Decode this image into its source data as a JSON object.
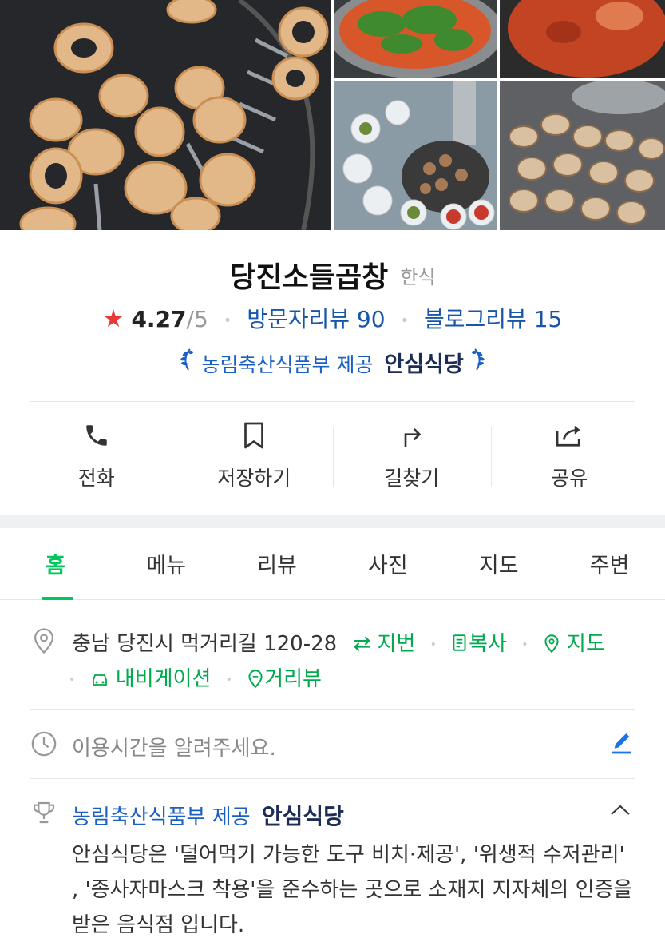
{
  "restaurant": {
    "name": "당진소들곱창",
    "category": "한식",
    "rating_star": "★",
    "rating": "4.27",
    "rating_max": "/5",
    "visitor_reviews": "방문자리뷰 90",
    "blog_reviews": "블로그리뷰 15"
  },
  "certification": {
    "provider": "농림축산식품부 제공",
    "badge": "안심식당"
  },
  "actions": [
    {
      "label": "전화",
      "icon": "phone-icon"
    },
    {
      "label": "저장하기",
      "icon": "bookmark-icon"
    },
    {
      "label": "길찾기",
      "icon": "directions-icon"
    },
    {
      "label": "공유",
      "icon": "share-icon"
    }
  ],
  "tabs": [
    "홈",
    "메뉴",
    "리뷰",
    "사진",
    "지도",
    "주변"
  ],
  "active_tab": "홈",
  "address": {
    "text": "충남 당진시 먹거리길 120-28",
    "jibun": "지번",
    "copy": "복사",
    "map": "지도",
    "navigation": "내비게이션",
    "street_view": "거리뷰"
  },
  "hours": {
    "placeholder": "이용시간을 알려주세요."
  },
  "cert_section": {
    "provider": "농림축산식품부 제공",
    "badge": "안심식당",
    "description": "안심식당은 '덜어먹기 가능한 도구 비치·제공', '위생적 수저관리' , '종사자마스크 착용'을 준수하는 곳으로 소재지 지자체의 인증을 받은 음식점 입니다."
  },
  "colors": {
    "accent_green": "#03c75a",
    "link_blue": "#1756a9",
    "star_red": "#e83838",
    "cert_navy": "#1b2d57"
  }
}
